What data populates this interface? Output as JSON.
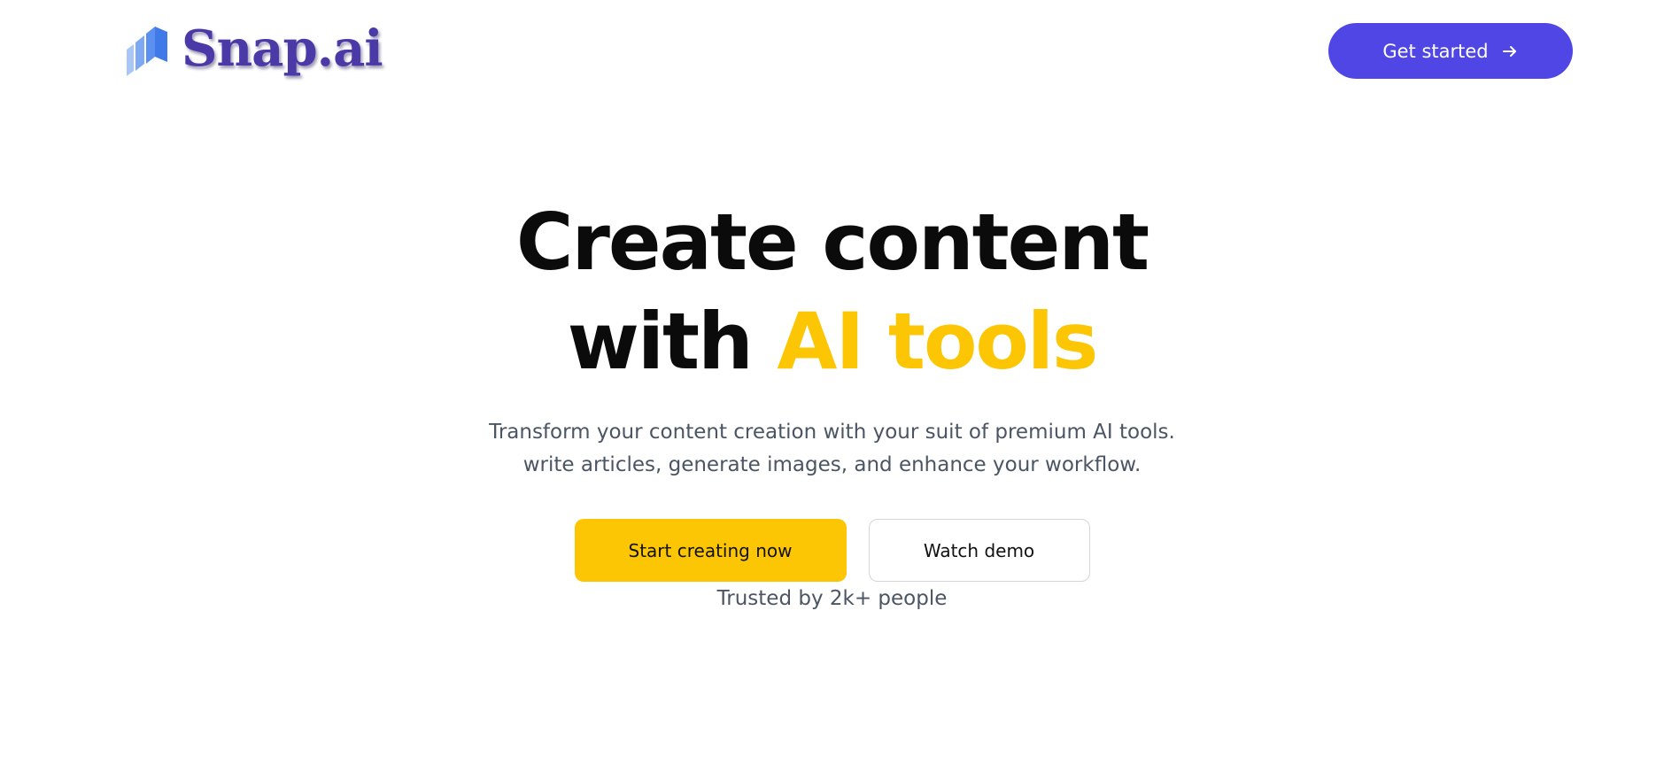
{
  "header": {
    "logo_text": "Snap.ai",
    "get_started_label": "Get started"
  },
  "hero": {
    "title_line1": "Create content",
    "title_line2_plain": "with ",
    "title_line2_accent": "AI tools",
    "subtitle": "Transform your content creation with your suit of premium AI tools. write articles, generate images, and enhance your workflow.",
    "primary_cta": "Start creating now",
    "secondary_cta": "Watch demo",
    "trusted_text": "Trusted by 2k+ people"
  },
  "icons": {
    "logo_mark": "stacked-bars-logo-icon",
    "get_started_icon": "arrow-right-icon"
  },
  "colors": {
    "brand_purple": "#4f46e5",
    "accent_yellow": "#fcc605",
    "logo_text": "#4a3aa8",
    "muted_text": "#4b5563"
  }
}
